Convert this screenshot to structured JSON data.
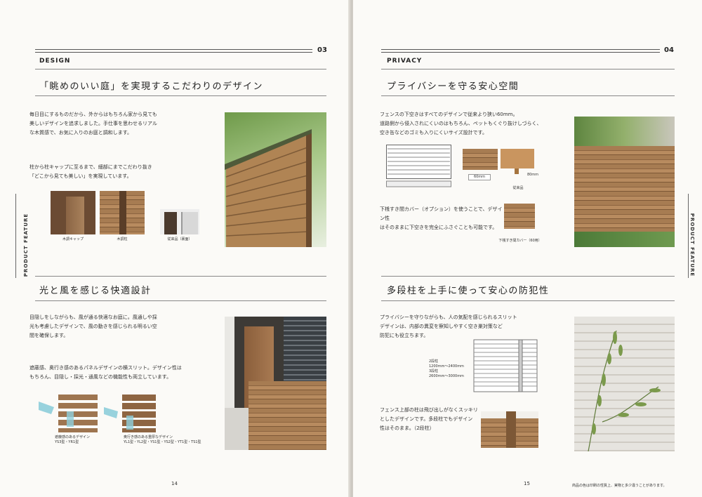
{
  "left": {
    "section_label": "DESIGN",
    "page_top": "03",
    "side_tab": "PRODUCT FEATURE",
    "design": {
      "title": "「眺めのいい庭」を実現するこだわりのデザイン",
      "text1": "毎日目にするものだから、外からはもちろん家から見ても\n美しいデザインを追求しました。手仕事を思わせるリアル\nな木質感で、お気に入りのお庭と調和します。",
      "text2": "柱から柱キャップに至るまで、細部にまでこだわり抜き\n「どこから見ても美しい」を実現しています。",
      "captions": [
        "木調キャップ",
        "木調柱",
        "従来品（裏面）"
      ]
    },
    "light": {
      "title": "光と風を感じる快適設計",
      "text1": "目隠しをしながらも、風が通る快適なお庭に。風通しや採\n光も考慮したデザインで、風の動きを感じられる明るい空\n間を確保します。",
      "text2": "遮蔽感、奥行き感のあるパネルデザインの横スリット。デザイン性は\nもちろん、目隠し・採光・通風などの機能性も両立しています。",
      "caption_a": "遮蔽感のあるデザイン\nYS3型・YR1型",
      "caption_b": "奥行き感のある重厚なデザイン\nYL1型・YL2型・YS1型・YS2型・YT1型・TS1型"
    },
    "page_number": "14"
  },
  "right": {
    "section_label": "PRIVACY",
    "page_top": "04",
    "side_tab": "PRODUCT FEATURE",
    "privacy": {
      "title": "プライバシーを守る安心空間",
      "text1": "フェンスの下空きはすべてのデザインで従来より狭い60mm。\n道路側から侵入されにくいのはもちろん、ペットもくぐり抜けしづらく、\n空き缶などのゴミも入りにくいサイズ設計です。",
      "dim_a": "60mm",
      "dim_b": "80mm",
      "caption_old": "従来品",
      "text2": "下桟すき間カバー（オプション）を使うことで、デザイン性\nはそのままに下空きを完全にふさぐことも可能です。",
      "caption_cover": "下桟すき間カバー（60用）"
    },
    "security": {
      "title": "多段柱を上手に使って安心の防犯性",
      "text1": "プライバシーを守りながらも、人の気配を感じられるスリット\nデザインは、内部の異変を察知しやすく空き巣対策など\n防犯にも役立ちます。",
      "spec": "2段柱\n1200mm〜2400mm\n3段柱\n2600mm〜3000mm",
      "text2": "フェンス上部の柱は飛び出しがなくスッキリ\nとしたデザインです。多段柱でもデザイン\n性はそのまま。（2段柱）"
    },
    "page_number": "15",
    "note": "商品の色は印刷の性質上、実物と多少違うことがあります。"
  }
}
